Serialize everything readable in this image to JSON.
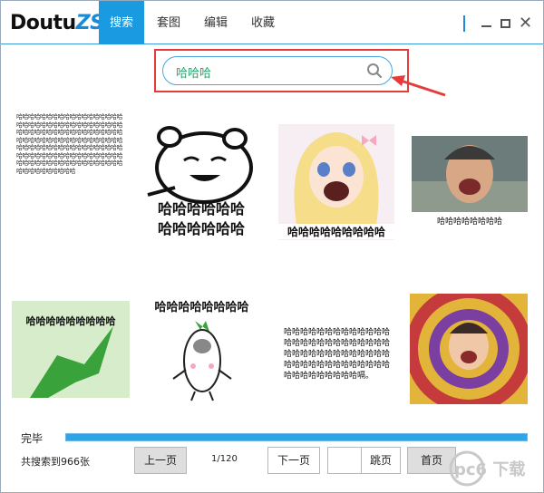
{
  "app": {
    "logo_main": "Doutu",
    "logo_accent": "ZS",
    "tabs": [
      {
        "label": "搜索",
        "active": true
      },
      {
        "label": "套图",
        "active": false
      },
      {
        "label": "编辑",
        "active": false
      },
      {
        "label": "收藏",
        "active": false
      }
    ]
  },
  "search": {
    "value": "哈哈哈"
  },
  "results": {
    "img1_text": "哈哈哈哈哈哈哈哈哈哈哈哈哈哈哈哈哈哈哈哈哈哈哈哈哈哈哈哈哈哈哈哈哈哈哈哈哈哈哈哈哈哈哈哈哈哈哈哈哈哈哈哈哈哈哈哈哈哈哈哈哈哈哈哈哈哈哈哈哈哈哈哈哈哈哈哈哈哈哈哈哈哈哈哈哈哈哈哈哈哈哈哈哈哈哈哈哈哈哈哈哈哈哈哈哈哈哈哈哈哈哈哈哈哈哈哈哈哈哈哈哈哈哈哈哈哈哈哈哈哈哈哈哈哈哈哈",
    "img2_line1": "哈哈哈哈哈哈",
    "img2_line2": "哈哈哈哈哈哈",
    "img3_caption": "哈哈哈哈哈哈哈哈哈",
    "img4_caption": "哈哈哈哈哈哈哈哈",
    "img5_caption": "哈哈哈哈哈哈哈哈哈",
    "img6_caption": "哈哈哈哈哈哈哈哈",
    "img7_lines": [
      "哈哈哈哈哈哈哈哈哈哈哈哈哈",
      "哈哈哈哈哈哈哈哈哈哈哈哈哈",
      "哈哈哈哈哈哈哈哈哈哈哈哈哈",
      "哈哈哈哈哈哈哈哈哈哈哈哈哈",
      "哈哈哈哈哈哈哈哈哈嗝。"
    ]
  },
  "footer": {
    "status": "完毕",
    "progress": 1.0,
    "count": "共搜索到966张",
    "prev": "上一页",
    "page": "1/120",
    "next": "下一页",
    "jump": "跳页",
    "first": "首页",
    "watermark": "pc6 下载"
  },
  "colors": {
    "accent": "#1a9ae0",
    "highlight": "#e63b3b",
    "search_text": "#24a36c"
  }
}
